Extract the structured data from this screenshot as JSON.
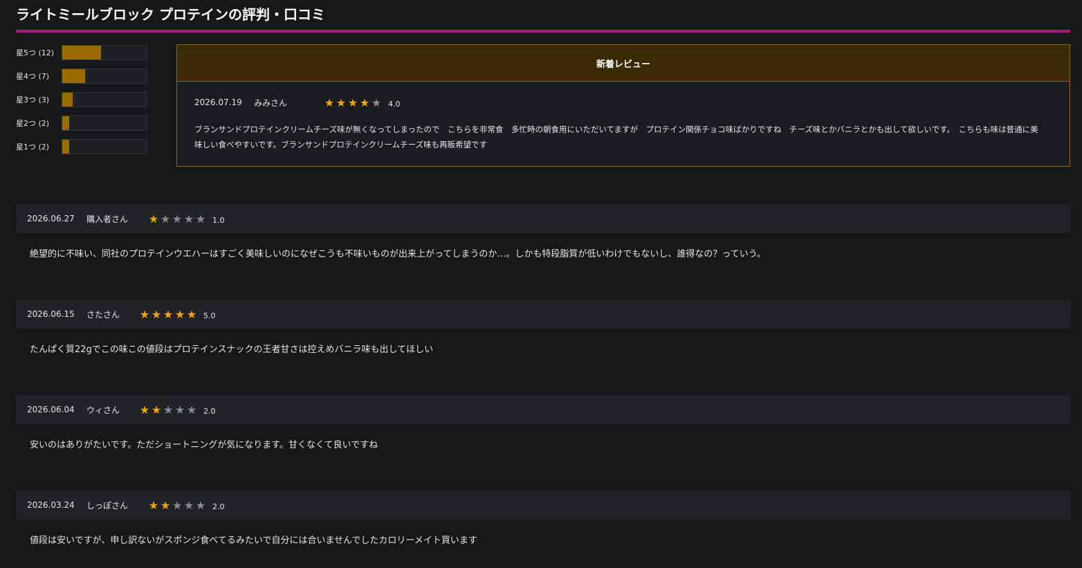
{
  "page_title": "ライトミールブロック プロテインの評判・口コミ",
  "distribution": [
    {
      "label": "星5つ (12)",
      "fill": 0.46
    },
    {
      "label": "星4つ (7)",
      "fill": 0.27
    },
    {
      "label": "星3つ (3)",
      "fill": 0.12
    },
    {
      "label": "星2つ (2)",
      "fill": 0.08
    },
    {
      "label": "星1つ (2)",
      "fill": 0.08
    }
  ],
  "new_review": {
    "heading": "新着レビュー",
    "date": "2026.07.19",
    "name": "みみさん",
    "rating": 4,
    "score": "4.0",
    "text": "ブランサンドプロテインクリームチーズ味が無くなってしまったので　こちらを非常食　多忙時の朝食用にいただいてますが　プロテイン関係チョコ味ばかりですね　チーズ味とかバニラとかも出して欲しいです。　こちらも味は普通に美味しい食べやすいです。ブランサンドプロテインクリームチーズ味も再販希望です"
  },
  "reviews": [
    {
      "date": "2026.06.27",
      "name": "購入者さん",
      "rating": 1,
      "score": "1.0",
      "text": "絶望的に不味い、同社のプロテインウエハーはすごく美味しいのになぜこうも不味いものが出来上がってしまうのか…。しかも特段脂質が低いわけでもないし、誰得なの？っていう。"
    },
    {
      "date": "2026.06.15",
      "name": "さたさん",
      "rating": 5,
      "score": "5.0",
      "text": "たんぱく質22gでこの味この値段はプロテインスナックの王者甘さは控えめバニラ味も出してほしい"
    },
    {
      "date": "2026.06.04",
      "name": "ウィさん",
      "rating": 2,
      "score": "2.0",
      "text": "安いのはありがたいです。ただショートニングが気になります。甘くなくて良いですね"
    },
    {
      "date": "2026.03.24",
      "name": "しっぽさん",
      "rating": 2,
      "score": "2.0",
      "text": "値段は安いですが、申し訳ないがスポンジ食べてるみたいで自分には合いませんでしたカロリーメイト買います"
    }
  ],
  "colors": {
    "accent_rule": "#b3167e",
    "star_on": "#f6a800",
    "star_off": "#888b91",
    "bar_fill": "#9a6c00"
  },
  "icons": {
    "star": "star-icon"
  }
}
